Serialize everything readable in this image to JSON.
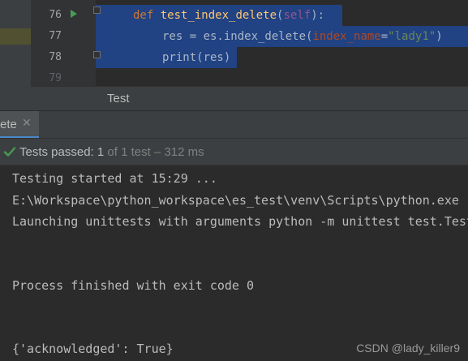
{
  "editor": {
    "line_numbers": [
      "76",
      "77",
      "78",
      "79"
    ],
    "line76": {
      "kw": "def",
      "fn": "test_index_delete",
      "open": "(",
      "self": "self",
      "close": "):"
    },
    "line77": {
      "pre": "res = es.index_delete(",
      "param": "index_name",
      "eq": "=",
      "str": "\"lady1\"",
      "close": ")"
    },
    "line78": {
      "text": "print(res)"
    }
  },
  "breadcrumb": {
    "label": "Test"
  },
  "run_tab": {
    "label": "ete",
    "close_icon": "close-icon"
  },
  "test_status": {
    "icon": "check-icon",
    "main": "Tests passed: 1",
    "sub": " of 1 test – 312 ms"
  },
  "console": {
    "lines": [
      "Testing started at 15:29 ...",
      "E:\\Workspace\\python_workspace\\es_test\\venv\\Scripts\\python.exe \"",
      "Launching unittests with arguments python -m unittest test.Test",
      "Process finished with exit code 0",
      "{'acknowledged': True}"
    ]
  },
  "watermark": "CSDN @lady_killer9",
  "colors": {
    "background": "#2b2b2b",
    "selection": "#214283",
    "keyword": "#cc7832",
    "function": "#ffc66d",
    "self": "#94558d",
    "string": "#6a8759",
    "pass_green": "#499c54"
  }
}
